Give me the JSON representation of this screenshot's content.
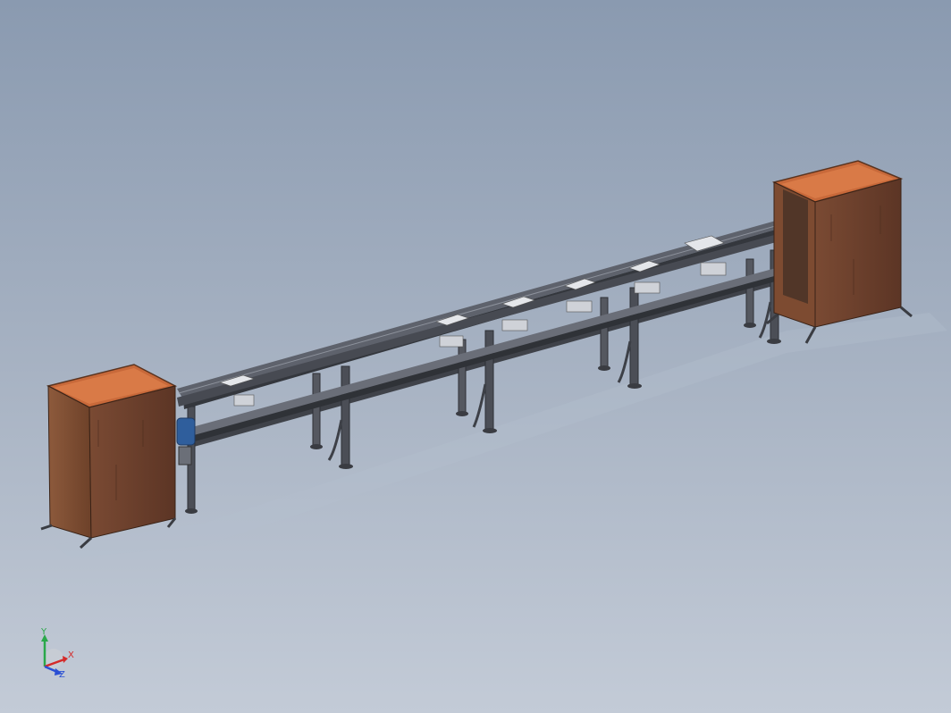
{
  "viewport": {
    "background_top": "#8a9ab0",
    "background_bottom": "#c3cbd7"
  },
  "model": {
    "frame_color": "#4a4d56",
    "cabinet_front_color": "#6a3f2d",
    "cabinet_top_color": "#c8693a",
    "motor_color": "#2f5e9c",
    "tray_color": "#e4e6ea"
  },
  "triad": {
    "x_label": "X",
    "y_label": "Y",
    "z_label": "Z",
    "x_color": "#d42a2a",
    "y_color": "#2aa84a",
    "z_color": "#2a4fd4"
  }
}
